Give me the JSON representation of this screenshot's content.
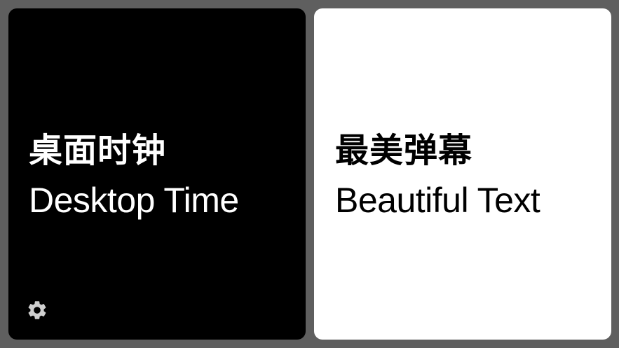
{
  "cards": {
    "left": {
      "title_cn": "桌面时钟",
      "title_en": "Desktop Time",
      "background": "#000000",
      "text_color": "#ffffff"
    },
    "right": {
      "title_cn": "最美弹幕",
      "title_en": "Beautiful Text",
      "background": "#ffffff",
      "text_color": "#000000"
    }
  },
  "settings": {
    "icon": "gear-icon",
    "color": "#cfcfcf"
  },
  "backdrop_color": "#5f5f5f"
}
